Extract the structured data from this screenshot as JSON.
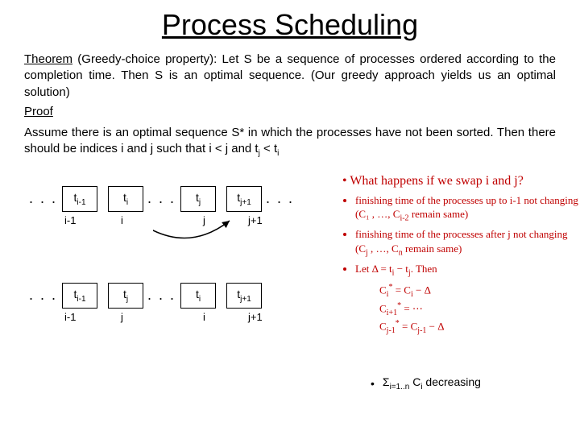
{
  "title": "Process Scheduling",
  "theorem_label": "Theorem",
  "theorem_body": " (Greedy-choice property): Let S be a sequence of processes ordered according to the completion time. Then S is an optimal sequence. (Our greedy approach yields us an optimal solution)",
  "proof_label": "Proof",
  "assume": "Assume there is an optimal sequence S* in which the processes have not been sorted. Then there should be indices i and j such that i < j and t",
  "assume_tail": " < t",
  "row1": {
    "c1": "t",
    "c1s": "i-1",
    "c2": "t",
    "c2s": "i",
    "c3": "t",
    "c3s": "j",
    "c4": "t",
    "c4s": "j+1",
    "i1": "i-1",
    "i2": "i",
    "i3": "j",
    "i4": "j+1"
  },
  "row2": {
    "c1": "t",
    "c1s": "i-1",
    "c2": "t",
    "c2s": "j",
    "c3": "t",
    "c3s": "i",
    "c4": "t",
    "c4s": "j+1",
    "i1": "i-1",
    "i2": "j",
    "i3": "i",
    "i4": "j+1"
  },
  "dots": ". . .",
  "red": {
    "q": "What happens if we swap i and j?",
    "b1a": "finishing time of the processes up to i-1 not changing",
    "b1b": "(C₁ , …, C",
    "b1c": " remain same)",
    "b2a": "finishing time of the processes after j not changing",
    "b2b": "(C",
    "b2c": " , …, C",
    "b2d": " remain same)",
    "b3a": "Let Δ = t",
    "b3b": " − t",
    "b3c": ". Then",
    "eq1a": "C",
    "eq1b": " = C",
    "eq1c": " − Δ",
    "eq2a": "C",
    "eq2b": " = ⋯",
    "eq3a": "C",
    "eq3b": " = C",
    "eq3c": " − Δ"
  },
  "bottom": {
    "sigma": "Σ",
    "range": "i=1..n",
    "var": " C",
    "varsub": "i",
    "tail": " decreasing"
  }
}
